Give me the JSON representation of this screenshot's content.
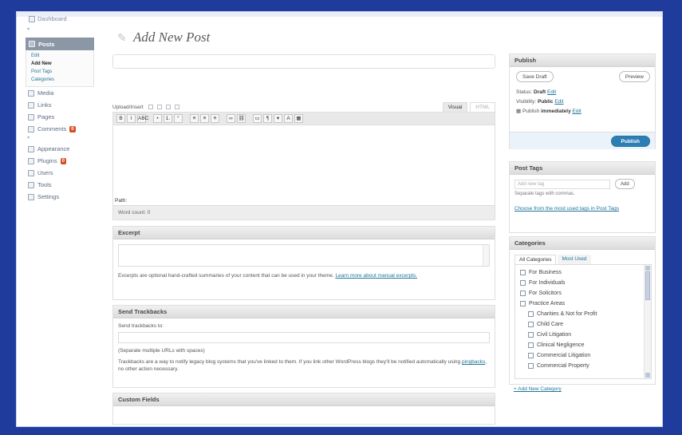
{
  "sidebar": {
    "dashboard": "Dashboard",
    "posts": "Posts",
    "posts_sub": [
      "Edit",
      "Add New",
      "Post Tags",
      "Categories"
    ],
    "posts_sub_current": 1,
    "items": [
      {
        "label": "Media",
        "icon": "media-icon"
      },
      {
        "label": "Links",
        "icon": "links-icon"
      },
      {
        "label": "Pages",
        "icon": "pages-icon"
      },
      {
        "label": "Comments",
        "icon": "comments-icon",
        "badge": "0"
      }
    ],
    "items2": [
      {
        "label": "Appearance",
        "icon": "appearance-icon"
      },
      {
        "label": "Plugins",
        "icon": "plugins-icon",
        "badge": "0"
      },
      {
        "label": "Users",
        "icon": "users-icon"
      },
      {
        "label": "Tools",
        "icon": "tools-icon"
      },
      {
        "label": "Settings",
        "icon": "settings-icon"
      }
    ]
  },
  "page": {
    "title": "Add New Post"
  },
  "editor": {
    "upload_label": "Upload/Insert",
    "tab_visual": "Visual",
    "tab_html": "HTML",
    "format_buttons": [
      "B",
      "I",
      "ABC",
      "•",
      "1.",
      "“",
      "≡",
      "≡",
      "≡",
      "∞",
      "⛓",
      "▭",
      "¶",
      "▾",
      "A",
      "▦"
    ],
    "path_label": "Path:",
    "word_count": "Word count: 0"
  },
  "excerpt": {
    "heading": "Excerpt",
    "help_text": "Excerpts are optional hand-crafted summaries of your content that can be used in your theme.",
    "help_link": "Learn more about manual excerpts."
  },
  "trackbacks": {
    "heading": "Send Trackbacks",
    "label": "Send trackbacks to:",
    "hint": "(Separate multiple URLs with spaces)",
    "desc_before": "Trackbacks are a way to notify legacy blog systems that you've linked to them. If you link other WordPress blogs they'll be notified automatically using",
    "desc_link": "pingbacks",
    "desc_after": ", no other action necessary."
  },
  "custom_fields": {
    "heading": "Custom Fields"
  },
  "publish": {
    "heading": "Publish",
    "save_draft": "Save Draft",
    "preview": "Preview",
    "status_label": "Status:",
    "status_value": "Draft",
    "visibility_label": "Visibility:",
    "visibility_value": "Public",
    "publish_label": "Publish",
    "publish_value": "immediately",
    "edit": "Edit",
    "publish_button": "Publish"
  },
  "tags": {
    "heading": "Post Tags",
    "input_placeholder": "Add new tag",
    "add_button": "Add",
    "separator_hint": "Separate tags with commas.",
    "choose_link": "Choose from the most used tags in Post Tags"
  },
  "categories": {
    "heading": "Categories",
    "tab_all": "All Categories",
    "tab_most": "Most Used",
    "items": [
      {
        "label": "For Business",
        "level": 0
      },
      {
        "label": "For Individuals",
        "level": 0
      },
      {
        "label": "For Solicitors",
        "level": 0
      },
      {
        "label": "Practice Areas",
        "level": 0
      },
      {
        "label": "Charities & Not for Profit",
        "level": 1
      },
      {
        "label": "Child Care",
        "level": 1
      },
      {
        "label": "Civil Litigation",
        "level": 1
      },
      {
        "label": "Clinical Negligence",
        "level": 1
      },
      {
        "label": "Commercial Litigation",
        "level": 1
      },
      {
        "label": "Commercial Property",
        "level": 1
      }
    ],
    "add_new": "+ Add New Category"
  }
}
